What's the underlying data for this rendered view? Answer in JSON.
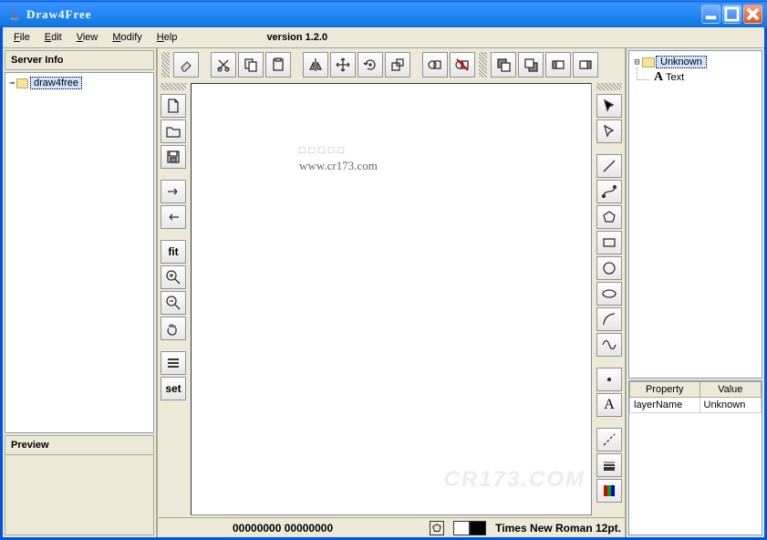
{
  "window": {
    "title": "Draw4Free"
  },
  "menu": {
    "file": "File",
    "edit": "Edit",
    "view": "View",
    "modify": "Modify",
    "help": "Help",
    "version": "version 1.2.0"
  },
  "server_panel": {
    "title": "Server Info",
    "root": "draw4free"
  },
  "preview_panel": {
    "title": "Preview"
  },
  "left_toolbar": {
    "fit": "fit",
    "set": "set"
  },
  "canvas": {
    "placeholder": "□□□□□",
    "text": "www.cr173.com"
  },
  "status": {
    "coords": "00000000 00000000",
    "font": "Times New Roman 12pt."
  },
  "object_tree": {
    "root": "Unknown",
    "child": "Text"
  },
  "properties": {
    "col_property": "Property",
    "col_value": "Value",
    "rows": [
      {
        "k": "layerName",
        "v": "Unknown"
      }
    ]
  },
  "watermark": "CR173.COM"
}
